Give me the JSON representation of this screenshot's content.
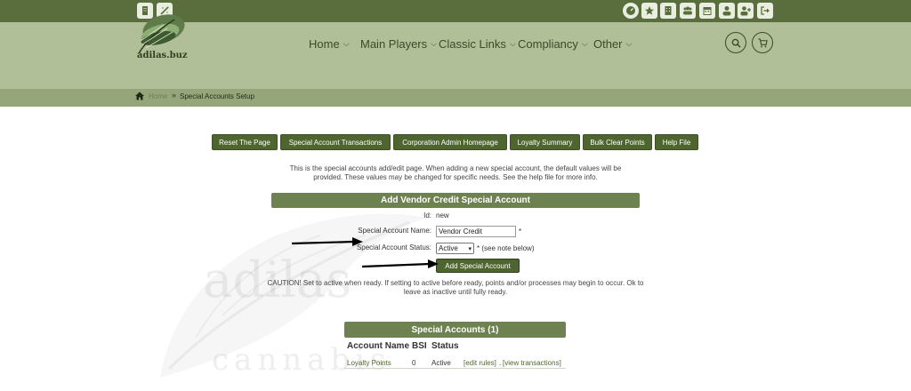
{
  "topbar": {
    "left_icons": [
      "building-icon",
      "magic-wand-icon"
    ],
    "right_icons": [
      "dashboard-icon",
      "star-icon",
      "office-icon",
      "users-icon",
      "calendar-icon",
      "user-icon",
      "user-plus-icon",
      "sign-out-icon"
    ]
  },
  "header": {
    "logo_text": "adilas.buz",
    "nav": [
      "Home",
      "Main Players",
      "Classic Links",
      "Compliancy",
      "Other"
    ],
    "search_icon": "search-icon",
    "cart_icon": "cart-icon"
  },
  "breadcrumb": {
    "home": "Home",
    "current": "Special Accounts Setup"
  },
  "toolbar": {
    "buttons": [
      "Reset The Page",
      "Special Account Transactions",
      "Corporation Admin Homepage",
      "Loyalty Summary",
      "Bulk Clear Points",
      "Help File"
    ]
  },
  "intro_text": "This is the special accounts add/edit page. When adding a new special account, the default values will be provided. These values may be changed for specific needs. See the help file for more info.",
  "form": {
    "title": "Add Vendor Credit Special Account",
    "id_label": "Id:",
    "id_value": "new",
    "name_label": "Special Account Name:",
    "name_value": "Vendor Credit",
    "name_required": "*",
    "status_label": "Special Account Status:",
    "status_value": "Active",
    "status_note": "* (see note below)",
    "submit_label": "Add Special Account",
    "caution_text": "CAUTION! Set to active when ready. If setting to active before ready, points and/or processes may begin to occur. Ok to leave as inactive until fully ready."
  },
  "accounts": {
    "title": "Special Accounts (1)",
    "columns": [
      "Account Name",
      "BSI",
      "Status"
    ],
    "rows": [
      {
        "name": "Loyalty Points",
        "bsi": "0",
        "status": "Active",
        "edit": "[edit rules]",
        "sep": ".",
        "view": "[view transactions]"
      }
    ]
  },
  "watermark": {
    "line1": "adilas",
    "line2": "cannabis"
  },
  "colors": {
    "topbar": "#596e3c",
    "header": "#b1bf99",
    "breadcrumb_bar": "#95a77a",
    "button": "#4f6530",
    "panel_title": "#6e8150"
  }
}
